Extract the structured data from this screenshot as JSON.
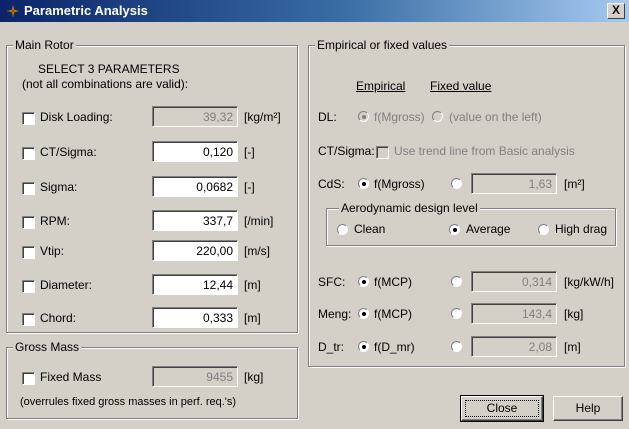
{
  "window": {
    "title": "Parametric Analysis",
    "close_glyph": "X"
  },
  "main_rotor": {
    "legend": "Main Rotor",
    "heading": "SELECT 3 PARAMETERS",
    "subheading": "(not all combinations are valid):",
    "rows": [
      {
        "label": "Disk Loading:",
        "value": "39,32",
        "unit": "[kg/m²]",
        "checked": false,
        "enabled": false
      },
      {
        "label": "CT/Sigma:",
        "value": "0,120",
        "unit": "[-]",
        "checked": false,
        "enabled": true
      },
      {
        "label": "Sigma:",
        "value": "0,0682",
        "unit": "[-]",
        "checked": false,
        "enabled": true
      },
      {
        "label": "RPM:",
        "value": "337,7",
        "unit": "[/min]",
        "checked": false,
        "enabled": true
      },
      {
        "label": "Vtip:",
        "value": "220,00",
        "unit": "[m/s]",
        "checked": false,
        "enabled": true
      },
      {
        "label": "Diameter:",
        "value": "12,44",
        "unit": "[m]",
        "checked": false,
        "enabled": true
      },
      {
        "label": "Chord:",
        "value": "0,333",
        "unit": "[m]",
        "checked": false,
        "enabled": true
      }
    ]
  },
  "gross_mass": {
    "legend": "Gross Mass",
    "fixed_label": "Fixed Mass",
    "value": "9455",
    "unit": "[kg]",
    "note": "(overrules fixed gross masses in perf. req.'s)"
  },
  "empirical": {
    "legend": "Empirical or fixed values",
    "col_empirical": "Empirical",
    "col_fixed": "Fixed value",
    "dl": {
      "label": "DL:",
      "empirical": "f(Mgross)",
      "fixed": "(value on the left)"
    },
    "ctsigma": {
      "label": "CT/Sigma:",
      "check_label": "Use trend line from Basic analysis"
    },
    "cds": {
      "label": "CdS:",
      "empirical": "f(Mgross)",
      "value": "1,63",
      "unit": "[m²]"
    },
    "aero": {
      "legend": "Aerodynamic design level",
      "options": [
        "Clean",
        "Average",
        "High drag"
      ],
      "selected": "Average"
    },
    "sfc": {
      "label": "SFC:",
      "empirical": "f(MCP)",
      "value": "0,314",
      "unit": "[kg/kW/h]"
    },
    "meng": {
      "label": "Meng:",
      "empirical": "f(MCP)",
      "value": "143,4",
      "unit": "[kg]"
    },
    "dtr": {
      "label": "D_tr:",
      "empirical": "f(D_mr)",
      "value": "2,08",
      "unit": "[m]"
    }
  },
  "buttons": {
    "close": "Close",
    "help": "Help"
  }
}
